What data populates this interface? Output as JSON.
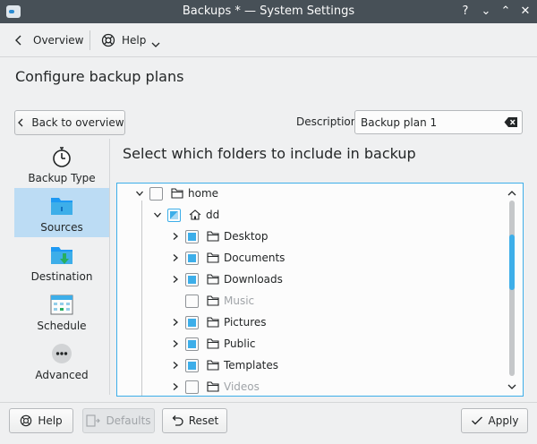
{
  "window": {
    "title": "Backups * — System Settings"
  },
  "titlebar": {
    "help_glyph": "?",
    "minimize_glyph": "⌄",
    "maximize_glyph": "⌃",
    "close_glyph": "✕"
  },
  "toolbar": {
    "overview_label": "Overview",
    "help_label": "Help"
  },
  "page": {
    "heading": "Configure backup plans"
  },
  "header": {
    "back_label": "Back to overview",
    "description_label": "Description:",
    "description_value": "Backup plan 1"
  },
  "sidebar": {
    "items": [
      {
        "label": "Backup Type",
        "icon": "backup-type-icon",
        "active": false
      },
      {
        "label": "Sources",
        "icon": "folder-icon",
        "active": true
      },
      {
        "label": "Destination",
        "icon": "destination-icon",
        "active": false
      },
      {
        "label": "Schedule",
        "icon": "calendar-icon",
        "active": false
      },
      {
        "label": "Advanced",
        "icon": "more-icon",
        "active": false
      }
    ]
  },
  "content": {
    "title": "Select which folders to include in backup"
  },
  "tree": {
    "rows": [
      {
        "label": "home",
        "state": "unchecked",
        "level": 0,
        "expanded": true,
        "dim": false,
        "icon": "folder-icon"
      },
      {
        "label": "dd",
        "state": "partial",
        "level": 1,
        "expanded": true,
        "dim": false,
        "icon": "home-icon"
      },
      {
        "label": "Desktop",
        "state": "checked",
        "level": 2,
        "expanded": false,
        "dim": false,
        "icon": "folder-icon"
      },
      {
        "label": "Documents",
        "state": "checked",
        "level": 2,
        "expanded": false,
        "dim": false,
        "icon": "folder-icon"
      },
      {
        "label": "Downloads",
        "state": "checked",
        "level": 2,
        "expanded": false,
        "dim": false,
        "icon": "folder-icon"
      },
      {
        "label": "Music",
        "state": "unchecked",
        "level": 2,
        "expanded": false,
        "dim": true,
        "icon": "folder-icon"
      },
      {
        "label": "Pictures",
        "state": "checked",
        "level": 2,
        "expanded": false,
        "dim": false,
        "icon": "folder-icon"
      },
      {
        "label": "Public",
        "state": "checked",
        "level": 2,
        "expanded": false,
        "dim": false,
        "icon": "folder-icon"
      },
      {
        "label": "Templates",
        "state": "checked",
        "level": 2,
        "expanded": false,
        "dim": false,
        "icon": "folder-icon"
      },
      {
        "label": "Videos",
        "state": "unchecked",
        "level": 2,
        "expanded": false,
        "dim": true,
        "icon": "folder-icon"
      }
    ]
  },
  "footer": {
    "help_label": "Help",
    "defaults_label": "Defaults",
    "reset_label": "Reset",
    "apply_label": "Apply"
  },
  "colors": {
    "accent": "#3daee9",
    "selection": "#bcdcf4",
    "titlebar": "#475057"
  }
}
